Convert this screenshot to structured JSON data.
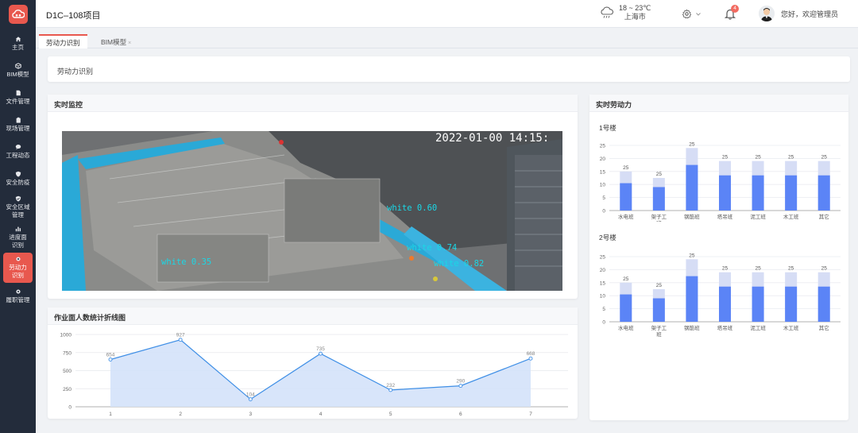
{
  "sidebar": {
    "items": [
      {
        "label": "主页",
        "icon": "home-icon"
      },
      {
        "label": "BIM模型",
        "icon": "cube-icon"
      },
      {
        "label": "文件管理",
        "icon": "file-icon"
      },
      {
        "label": "现场管理",
        "icon": "clipboard-icon"
      },
      {
        "label": "工程动态",
        "icon": "chat-icon"
      },
      {
        "label": "安全防疫",
        "icon": "shield-icon"
      },
      {
        "label": "安全区域管理",
        "line1": "安全区域",
        "line2": "管理",
        "icon": "shield-check-icon"
      },
      {
        "label": "进度面识别",
        "line1": "进度面",
        "line2": "识别",
        "icon": "bar-chart-icon"
      },
      {
        "label": "劳动力识别",
        "line1": "劳动力",
        "line2": "识别",
        "icon": "gear-small-icon",
        "active": true
      },
      {
        "label": "履职管理",
        "icon": "gear-small-icon"
      }
    ]
  },
  "header": {
    "project_title": "D1C–108项目",
    "weather": {
      "temp": "18 ~ 23℃",
      "city": "上海市",
      "icon": "cloud-rain-icon"
    },
    "notifications": "4",
    "greeting": "您好，欢迎管理员"
  },
  "tabs": [
    {
      "label": "劳动力识别",
      "active": true
    },
    {
      "label": "BIM模型",
      "close": "×"
    }
  ],
  "breadcrumb": "劳动力识别",
  "monitor": {
    "title": "实时监控",
    "timestamp": "2022-01-00 14:15:",
    "detections": [
      "white 0.60",
      "white 0.74",
      "white 0.35",
      "white 0.82"
    ]
  },
  "colors": {
    "accent": "#e8584e",
    "sidebar": "#232c3b",
    "bar_light": "#d6ddf5",
    "bar_dark": "#5b84f6",
    "line": "#3f8fe6",
    "area": "#d4e2fa"
  },
  "line_chart": {
    "title": "作业面人数统计折线图",
    "chart_data": {
      "type": "area",
      "x": [
        1,
        2,
        3,
        4,
        5,
        6,
        7
      ],
      "values": [
        654,
        927,
        104,
        735,
        232,
        290,
        668
      ],
      "yticks": [
        0,
        250,
        500,
        750,
        1000
      ],
      "ylim": [
        0,
        1000
      ]
    }
  },
  "labor": {
    "title": "实时劳动力",
    "chart_data": [
      {
        "type": "bar",
        "title": "1号楼",
        "categories": [
          "水电班",
          "架子工班",
          "钢筋班",
          "塔吊班",
          "泥工班",
          "木工班",
          "其它"
        ],
        "category_lines": [
          [
            "水电班"
          ],
          [
            "架子工",
            "班"
          ],
          [
            "钢筋班"
          ],
          [
            "塔吊班"
          ],
          [
            "泥工班"
          ],
          [
            "木工班"
          ],
          [
            "其它"
          ]
        ],
        "totals": [
          15,
          12.5,
          24,
          19,
          19,
          19,
          19
        ],
        "inner": [
          10.5,
          9,
          17.5,
          13.5,
          13.5,
          13.5,
          13.5
        ],
        "labels": [
          "25",
          "25",
          "25",
          "25",
          "25",
          "25",
          "25"
        ],
        "yticks": [
          0,
          5,
          10,
          15,
          20,
          25
        ],
        "ylim": [
          0,
          25
        ]
      },
      {
        "type": "bar",
        "title": "2号楼",
        "categories": [
          "水电班",
          "架子工班",
          "钢筋班",
          "塔吊班",
          "泥工班",
          "木工班",
          "其它"
        ],
        "category_lines": [
          [
            "水电班"
          ],
          [
            "架子工",
            "班"
          ],
          [
            "钢筋班"
          ],
          [
            "塔吊班"
          ],
          [
            "泥工班"
          ],
          [
            "木工班"
          ],
          [
            "其它"
          ]
        ],
        "totals": [
          15,
          12.5,
          24,
          19,
          19,
          19,
          19
        ],
        "inner": [
          10.5,
          9,
          17.5,
          13.5,
          13.5,
          13.5,
          13.5
        ],
        "labels": [
          "25",
          "25",
          "25",
          "25",
          "25",
          "25",
          "25"
        ],
        "yticks": [
          0,
          5,
          10,
          15,
          20,
          25
        ],
        "ylim": [
          0,
          25
        ]
      }
    ]
  }
}
